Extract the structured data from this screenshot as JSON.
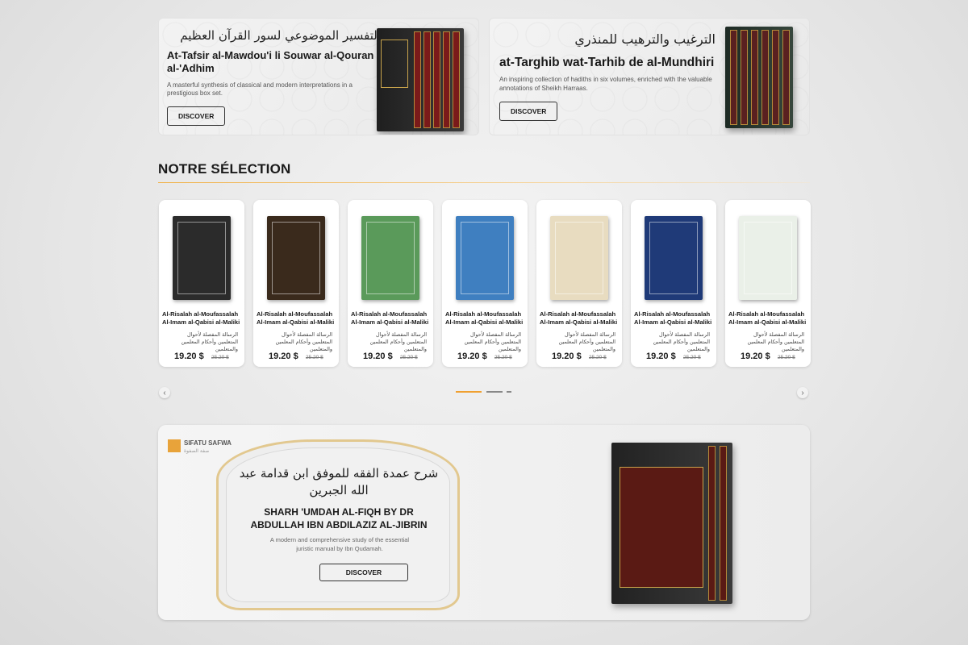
{
  "banners": [
    {
      "arabic_title": "التفسير الموضوعي لسور القرآن العظيم",
      "title": "At-Tafsir al-Mawdou'i li Souwar al-Qouran al-'Adhim",
      "description": "A masterful synthesis of classical and modern interpretations in a prestigious box set.",
      "button": "DISCOVER"
    },
    {
      "arabic_title": "الترغيب والترهيب للمنذري",
      "title": "at-Targhib wat-Tarhib de al-Mundhiri",
      "description": "An inspiring collection of hadiths in six volumes, enriched with the valuable annotations of Sheikh Harraas.",
      "button": "DISCOVER"
    }
  ],
  "selection": {
    "heading": "NOTRE SÉLECTION",
    "products": [
      {
        "title": "Al-Risalah al-Moufassalah Al-Imam al-Qabisi al-Maliki",
        "arabic": "الرسالة المفصلة لأحوال المتعلمين وأحكام المعلمين والمتعلمين",
        "price": "19.20 $",
        "old_price": "25.20 $",
        "cover_color": "#2b2b2b"
      },
      {
        "title": "Al-Risalah al-Moufassalah Al-Imam al-Qabisi al-Maliki",
        "arabic": "الرسالة المفصلة لأحوال المتعلمين وأحكام المعلمين والمتعلمين",
        "price": "19.20 $",
        "old_price": "25.20 $",
        "cover_color": "#3a2a1c"
      },
      {
        "title": "Al-Risalah al-Moufassalah Al-Imam al-Qabisi al-Maliki",
        "arabic": "الرسالة المفصلة لأحوال المتعلمين وأحكام المعلمين والمتعلمين",
        "price": "19.20 $",
        "old_price": "25.20 $",
        "cover_color": "#5a9a5a"
      },
      {
        "title": "Al-Risalah al-Moufassalah Al-Imam al-Qabisi al-Maliki",
        "arabic": "الرسالة المفصلة لأحوال المتعلمين وأحكام المعلمين والمتعلمين",
        "price": "19.20 $",
        "old_price": "25.20 $",
        "cover_color": "#3f7fc0"
      },
      {
        "title": "Al-Risalah al-Moufassalah Al-Imam al-Qabisi al-Maliki",
        "arabic": "الرسالة المفصلة لأحوال المتعلمين وأحكام المعلمين والمتعلمين",
        "price": "19.20 $",
        "old_price": "25.20 $",
        "cover_color": "#e8dcc0"
      },
      {
        "title": "Al-Risalah al-Moufassalah Al-Imam al-Qabisi al-Maliki",
        "arabic": "الرسالة المفصلة لأحوال المتعلمين وأحكام المعلمين والمتعلمين",
        "price": "19.20 $",
        "old_price": "25.20 $",
        "cover_color": "#1f3a78"
      },
      {
        "title": "Al-Risalah al-Moufassalah Al-Imam al-Qabisi al-Maliki",
        "arabic": "الرسالة المفصلة لأحوال المتعلمين وأحكام المعلمين والمتعلمين",
        "price": "19.20 $",
        "old_price": "25.20 $",
        "cover_color": "#eaf0e8"
      }
    ]
  },
  "carousel": {
    "prev_icon": "chevron-left-icon",
    "next_icon": "chevron-right-icon",
    "prev_glyph": "‹",
    "next_glyph": "›"
  },
  "feature": {
    "brand": "SIFATU SAFWA",
    "brand_ar": "صفة الصفوة",
    "arabic_title": "شرح عمدة الفقه للموفق ابن قدامة عبد الله الجبرين",
    "title": "SHARH 'UMDAH AL-FIQH BY DR ABDULLAH IBN ABDILAZIZ AL-JIBRIN",
    "description": "A modern and comprehensive study of the essential juristic manual by Ibn Qudamah.",
    "button": "DISCOVER"
  },
  "colors": {
    "accent": "#f0a030"
  }
}
